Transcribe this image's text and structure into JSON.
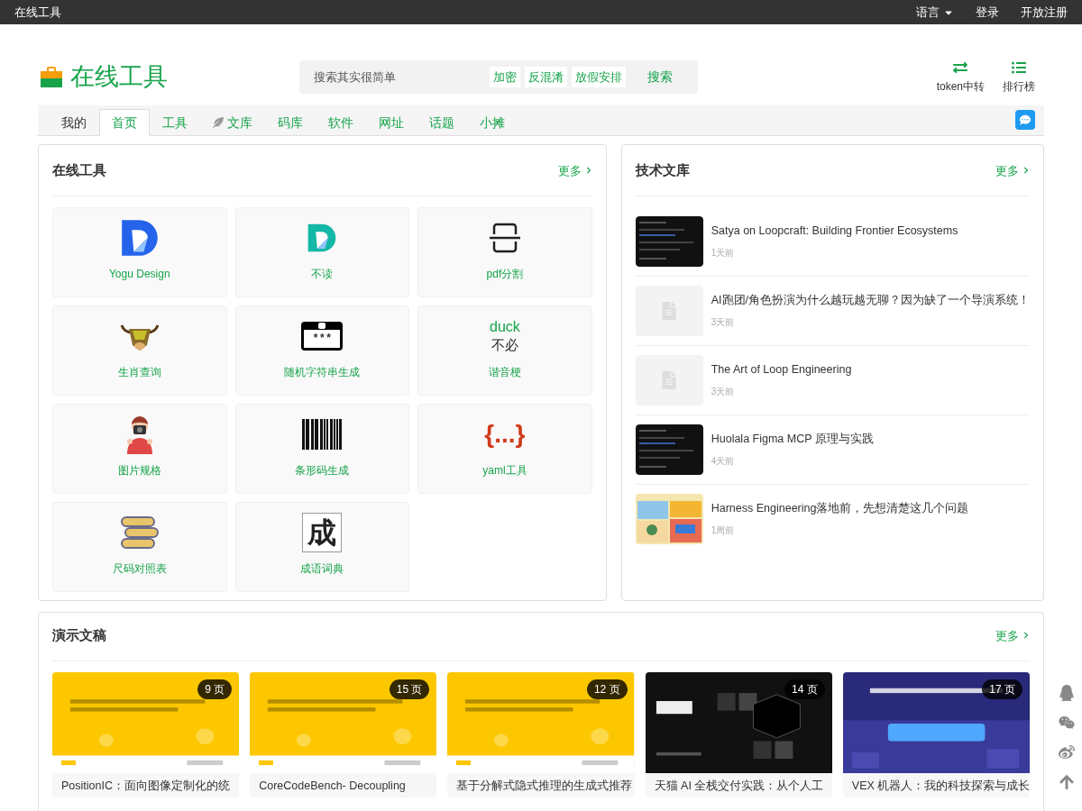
{
  "topbar": {
    "site": "在线工具",
    "links": [
      {
        "label": "语言",
        "dropdown": true
      },
      {
        "label": "登录",
        "dropdown": false
      },
      {
        "label": "开放注册",
        "dropdown": false
      }
    ]
  },
  "header": {
    "logo": "在线工具",
    "search": {
      "placeholder": "搜索其实很简单",
      "tags": [
        "加密",
        "反混淆",
        "放假安排"
      ],
      "button": "搜索"
    },
    "actions": [
      {
        "kind": "swap",
        "label": "token中转"
      },
      {
        "kind": "list",
        "label": "排行榜"
      }
    ]
  },
  "nav": {
    "tabs": [
      {
        "label": "我的",
        "selected": false,
        "color": "#333333",
        "icon": false
      },
      {
        "label": "首页",
        "selected": true,
        "color": "#16a34a",
        "icon": false
      },
      {
        "label": "工具",
        "selected": false,
        "color": "#16a34a",
        "icon": false
      },
      {
        "label": "文库",
        "selected": false,
        "color": "#16a34a",
        "icon": true
      },
      {
        "label": "码库",
        "selected": false,
        "color": "#16a34a",
        "icon": false
      },
      {
        "label": "软件",
        "selected": false,
        "color": "#16a34a",
        "icon": false
      },
      {
        "label": "网址",
        "selected": false,
        "color": "#16a34a",
        "icon": false
      },
      {
        "label": "话题",
        "selected": false,
        "color": "#16a34a",
        "icon": false
      },
      {
        "label": "小摊",
        "selected": false,
        "color": "#16a34a",
        "icon": false
      }
    ]
  },
  "tools_panel": {
    "title": "在线工具",
    "more": "更多",
    "items": [
      {
        "kind": "logo-blue",
        "name": "Yogu Design"
      },
      {
        "kind": "logo-teal",
        "name": "不读"
      },
      {
        "kind": "scan",
        "name": "pdf分割"
      },
      {
        "kind": "ox",
        "name": "生肖查询"
      },
      {
        "kind": "password",
        "name": "随机字符串生成",
        "glyph": "***"
      },
      {
        "kind": "text",
        "name": "谐音梗",
        "top": "duck",
        "bottom": "不必"
      },
      {
        "kind": "photographer",
        "name": "图片规格"
      },
      {
        "kind": "barcode",
        "name": "条形码生成"
      },
      {
        "kind": "braces",
        "name": "yaml工具",
        "glyph": "{...}"
      },
      {
        "kind": "tape",
        "name": "尺码对照表"
      },
      {
        "kind": "char",
        "name": "成语词典",
        "glyph": "成"
      }
    ]
  },
  "library_panel": {
    "title": "技术文库",
    "more": "更多",
    "items": [
      {
        "title": "Satya on Loopcraft: Building Frontier Ecosystems",
        "time": "1天前",
        "kind": "picture"
      },
      {
        "title": "AI跑团/角色扮演为什么越玩越无聊？因为缺了一个导演系统！",
        "time": "3天前",
        "kind": "placeholder"
      },
      {
        "title": "The Art of Loop Engineering",
        "time": "3天前",
        "kind": "placeholder"
      },
      {
        "title": "Huolala Figma MCP 原理与实践",
        "time": "4天前",
        "kind": "picture"
      },
      {
        "title": "Harness Engineering落地前，先想清楚这几个问题",
        "time": "1周前",
        "kind": "picture"
      }
    ]
  },
  "slides_panel": {
    "title": "演示文稿",
    "more": "更多",
    "items": [
      {
        "pages": "9 页",
        "title": "PositionIC：面向图像定制化的统"
      },
      {
        "pages": "15 页",
        "title": "CoreCodeBench- Decoupling"
      },
      {
        "pages": "12 页",
        "title": "基于分解式隐式推理的生成式推荐"
      },
      {
        "pages": "14 页",
        "title": "天猫 AI 全栈交付实践：从个人工"
      },
      {
        "pages": "17 页",
        "title": "VEX 机器人：我的科技探索与成长"
      }
    ]
  },
  "side_buttons": [
    {
      "kind": "qq"
    },
    {
      "kind": "wechat"
    },
    {
      "kind": "weibo"
    },
    {
      "kind": "top"
    }
  ]
}
